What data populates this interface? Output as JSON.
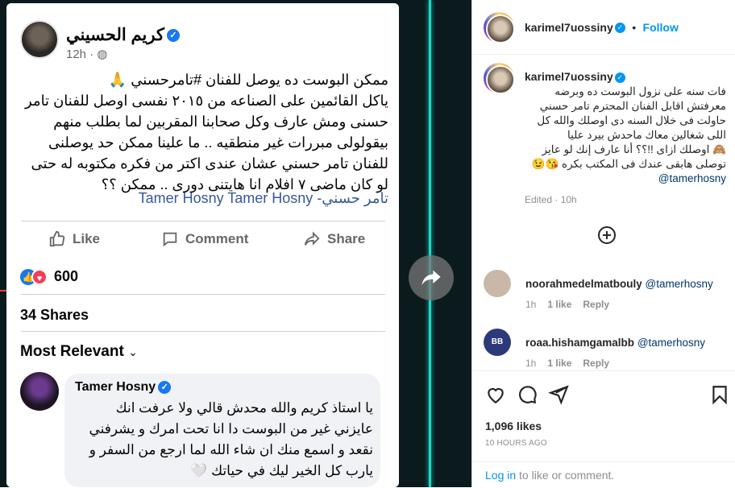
{
  "media": {
    "fb_post": {
      "author": "كريم الحسيني",
      "time": "12h · ",
      "body": "ممكن البوست ده يوصل للفنان #تامرحسني 🙏\nياكل القائمين على الصناعه من ٢٠١٥ نفسى اوصل للفنان تامر حسنى ومش عارف وكل صحابنا المقربين لما بطلب منهم بيقولولى مبررات غير منطقيه .. ما علينا ممكن حد يوصلنى للفنان تامر حسني عشان عندى اكتر من فكره مكتوبه له حتى لو كان ماضى ٧ افلام انا هايتنى دورى .. ممكن ؟؟",
      "tags": "تامر حسني- Tamer Hosny Tamer Hosny",
      "like_label": "Like",
      "comment_label": "Comment",
      "share_label": "Share",
      "reaction_count": "600",
      "shares_label": "34 Shares",
      "sort_label": "Most Relevant",
      "top_comment": {
        "author": "Tamer Hosny",
        "text": "يا استاذ كريم والله محدش قالي ولا عرفت انك عايزني غير من البوست دا انا تحت امرك و يشرفني نقعد و اسمع منك ان شاء الله لما ارجع من السفر و يارب كل الخير ليك في حياتك 🤍"
      }
    }
  },
  "instagram": {
    "header": {
      "username": "karimel7uossiny",
      "separator": "•",
      "follow_label": "Follow"
    },
    "caption": {
      "username": "karimel7uossiny",
      "text": "فات سنه على نزول البوست ده وبرضه معرفتش اقابل الفنان المحترم تامر حسني\nحاولت فى خلال السنه دى اوصلك والله كل اللى شغالين معاك ماحدش بيرد عليا\n🙈 اوصلك ازاى !!؟؟ أنا عارف إنك لو عايز توصلى هابقى عندك فى المكتب بكره 😘😉",
      "mention": "@tamerhosny",
      "edited": "Edited · 10h"
    },
    "comments": [
      {
        "username": "noorahmedelmatbouly",
        "mention": "@tamerhosny",
        "time": "1h",
        "likes": "1 like",
        "reply": "Reply",
        "avatar_color": "#c9b7a8"
      },
      {
        "username": "roaa.hishamgamalbb",
        "mention": "@tamerhosny",
        "time": "1h",
        "likes": "1 like",
        "reply": "Reply",
        "avatar_color": "#2d3a7a"
      }
    ],
    "likes": "1,096 likes",
    "posted": "10 HOURS AGO",
    "login_link": "Log in",
    "login_rest": " to like or comment."
  }
}
